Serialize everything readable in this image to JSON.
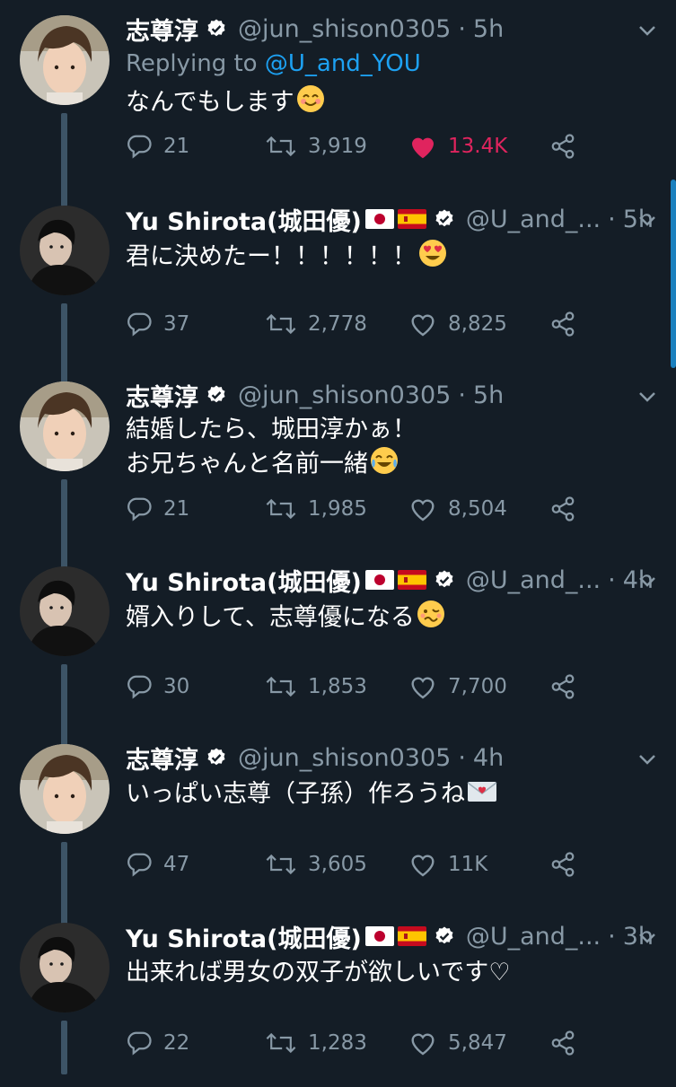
{
  "tweets": [
    {
      "name": "志尊淳",
      "handle": "@jun_shison0305",
      "time": "5h",
      "reply_prefix": "Replying to",
      "reply_handle": "@U_and_YOU",
      "lines": [
        "なんでもします"
      ],
      "emoji": "smiling-face-icon",
      "replies": "21",
      "retweets": "3,919",
      "likes": "13.4K",
      "liked": true,
      "author": "jun"
    },
    {
      "name": "Yu Shirota(城田優)",
      "handle": "@U_and_...",
      "time": "5h",
      "lines": [
        "君に決めたー！！！！！！"
      ],
      "emoji": "heart-eyes-icon",
      "replies": "37",
      "retweets": "2,778",
      "likes": "8,825",
      "liked": false,
      "author": "yu"
    },
    {
      "name": "志尊淳",
      "handle": "@jun_shison0305",
      "time": "5h",
      "lines": [
        "結婚したら、城田淳かぁ！",
        "お兄ちゃんと名前一緒"
      ],
      "emoji": "tears-of-joy-icon",
      "replies": "21",
      "retweets": "1,985",
      "likes": "8,504",
      "liked": false,
      "author": "jun"
    },
    {
      "name": "Yu Shirota(城田優)",
      "handle": "@U_and_...",
      "time": "4h",
      "lines": [
        "婿入りして、志尊優になる"
      ],
      "emoji": "woozy-face-icon",
      "replies": "30",
      "retweets": "1,853",
      "likes": "7,700",
      "liked": false,
      "author": "yu"
    },
    {
      "name": "志尊淳",
      "handle": "@jun_shison0305",
      "time": "4h",
      "lines": [
        "いっぱい志尊（子孫）作ろうね"
      ],
      "emoji": "love-letter-icon",
      "replies": "47",
      "retweets": "3,605",
      "likes": "11K",
      "liked": false,
      "author": "jun"
    },
    {
      "name": "Yu Shirota(城田優)",
      "handle": "@U_and_...",
      "time": "3h",
      "lines": [
        "出来れば男女の双子が欲しいです♡"
      ],
      "emoji": "",
      "replies": "22",
      "retweets": "1,283",
      "likes": "5,847",
      "liked": false,
      "author": "yu"
    }
  ],
  "colors": {
    "background": "#141d26",
    "secondary_text": "#8899a6",
    "link": "#1da1f2",
    "like_active": "#e0245e",
    "thread_line": "#3d5466"
  }
}
